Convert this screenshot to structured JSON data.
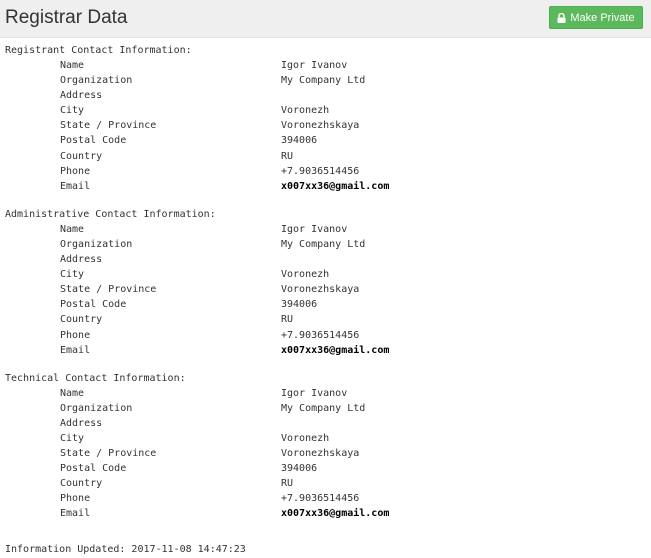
{
  "header": {
    "title": "Registrar Data",
    "make_private_label": "Make Private",
    "button_icon": "lock-icon",
    "accent_color": "#5cb85c"
  },
  "sections": [
    {
      "title": "Registrant Contact Information:",
      "rows": [
        {
          "label": "Name",
          "value": "Igor Ivanov"
        },
        {
          "label": "Organization",
          "value": "My Company Ltd"
        },
        {
          "label": "Address",
          "value": ""
        },
        {
          "label": "City",
          "value": "Voronezh"
        },
        {
          "label": "State / Province",
          "value": "Voronezhskaya"
        },
        {
          "label": "Postal Code",
          "value": "394006"
        },
        {
          "label": "Country",
          "value": "RU"
        },
        {
          "label": "Phone",
          "value": "+7.9036514456"
        },
        {
          "label": "Email",
          "value": "x007xx36@gmail.com"
        }
      ]
    },
    {
      "title": "Administrative Contact Information:",
      "rows": [
        {
          "label": "Name",
          "value": "Igor Ivanov"
        },
        {
          "label": "Organization",
          "value": "My Company Ltd"
        },
        {
          "label": "Address",
          "value": ""
        },
        {
          "label": "City",
          "value": "Voronezh"
        },
        {
          "label": "State / Province",
          "value": "Voronezhskaya"
        },
        {
          "label": "Postal Code",
          "value": "394006"
        },
        {
          "label": "Country",
          "value": "RU"
        },
        {
          "label": "Phone",
          "value": "+7.9036514456"
        },
        {
          "label": "Email",
          "value": "x007xx36@gmail.com"
        }
      ]
    },
    {
      "title": "Technical Contact Information:",
      "rows": [
        {
          "label": "Name",
          "value": "Igor Ivanov"
        },
        {
          "label": "Organization",
          "value": "My Company Ltd"
        },
        {
          "label": "Address",
          "value": ""
        },
        {
          "label": "City",
          "value": "Voronezh"
        },
        {
          "label": "State / Province",
          "value": "Voronezhskaya"
        },
        {
          "label": "Postal Code",
          "value": "394006"
        },
        {
          "label": "Country",
          "value": "RU"
        },
        {
          "label": "Phone",
          "value": "+7.9036514456"
        },
        {
          "label": "Email",
          "value": "x007xx36@gmail.com"
        }
      ]
    }
  ],
  "footer": {
    "updated_text": "Information Updated: 2017-11-08 14:47:23"
  }
}
